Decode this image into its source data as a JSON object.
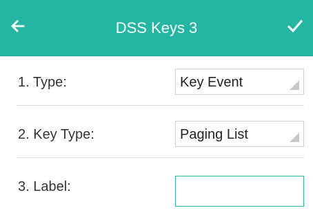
{
  "header": {
    "title": "DSS Keys 3",
    "back_icon": "arrow-left-icon",
    "confirm_icon": "check-icon"
  },
  "form": {
    "type": {
      "label": "1. Type:",
      "value": "Key Event"
    },
    "key_type": {
      "label": "2. Key Type:",
      "value": "Paging List"
    },
    "label_field": {
      "label": "3. Label:",
      "value": ""
    }
  },
  "colors": {
    "accent": "#24b6a3",
    "divider": "#dedede",
    "field_border": "#cfcfcf",
    "text": "#333333"
  }
}
